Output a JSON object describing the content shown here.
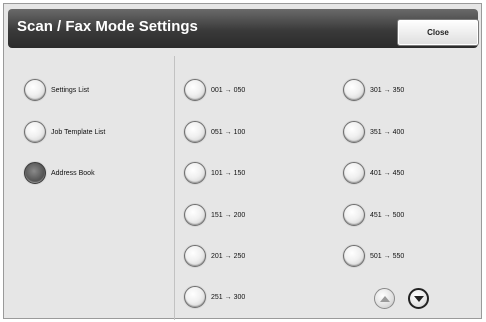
{
  "header": {
    "title": "Scan / Fax Mode Settings",
    "close_label": "Close"
  },
  "left_options": [
    {
      "label": "Settings List",
      "selected": false
    },
    {
      "label": "Job Template List",
      "selected": false
    },
    {
      "label": "Address Book",
      "selected": true
    }
  ],
  "ranges_col1": [
    "001 → 050",
    "051 → 100",
    "101 → 150",
    "151 → 200",
    "201 → 250",
    "251 → 300"
  ],
  "ranges_col2": [
    "301 → 350",
    "351 → 400",
    "401 → 450",
    "451 → 500",
    "501 → 550"
  ],
  "scroll": {
    "up_icon": "triangle-up-icon",
    "down_icon": "triangle-down-icon",
    "up_enabled": false,
    "down_enabled": true
  }
}
